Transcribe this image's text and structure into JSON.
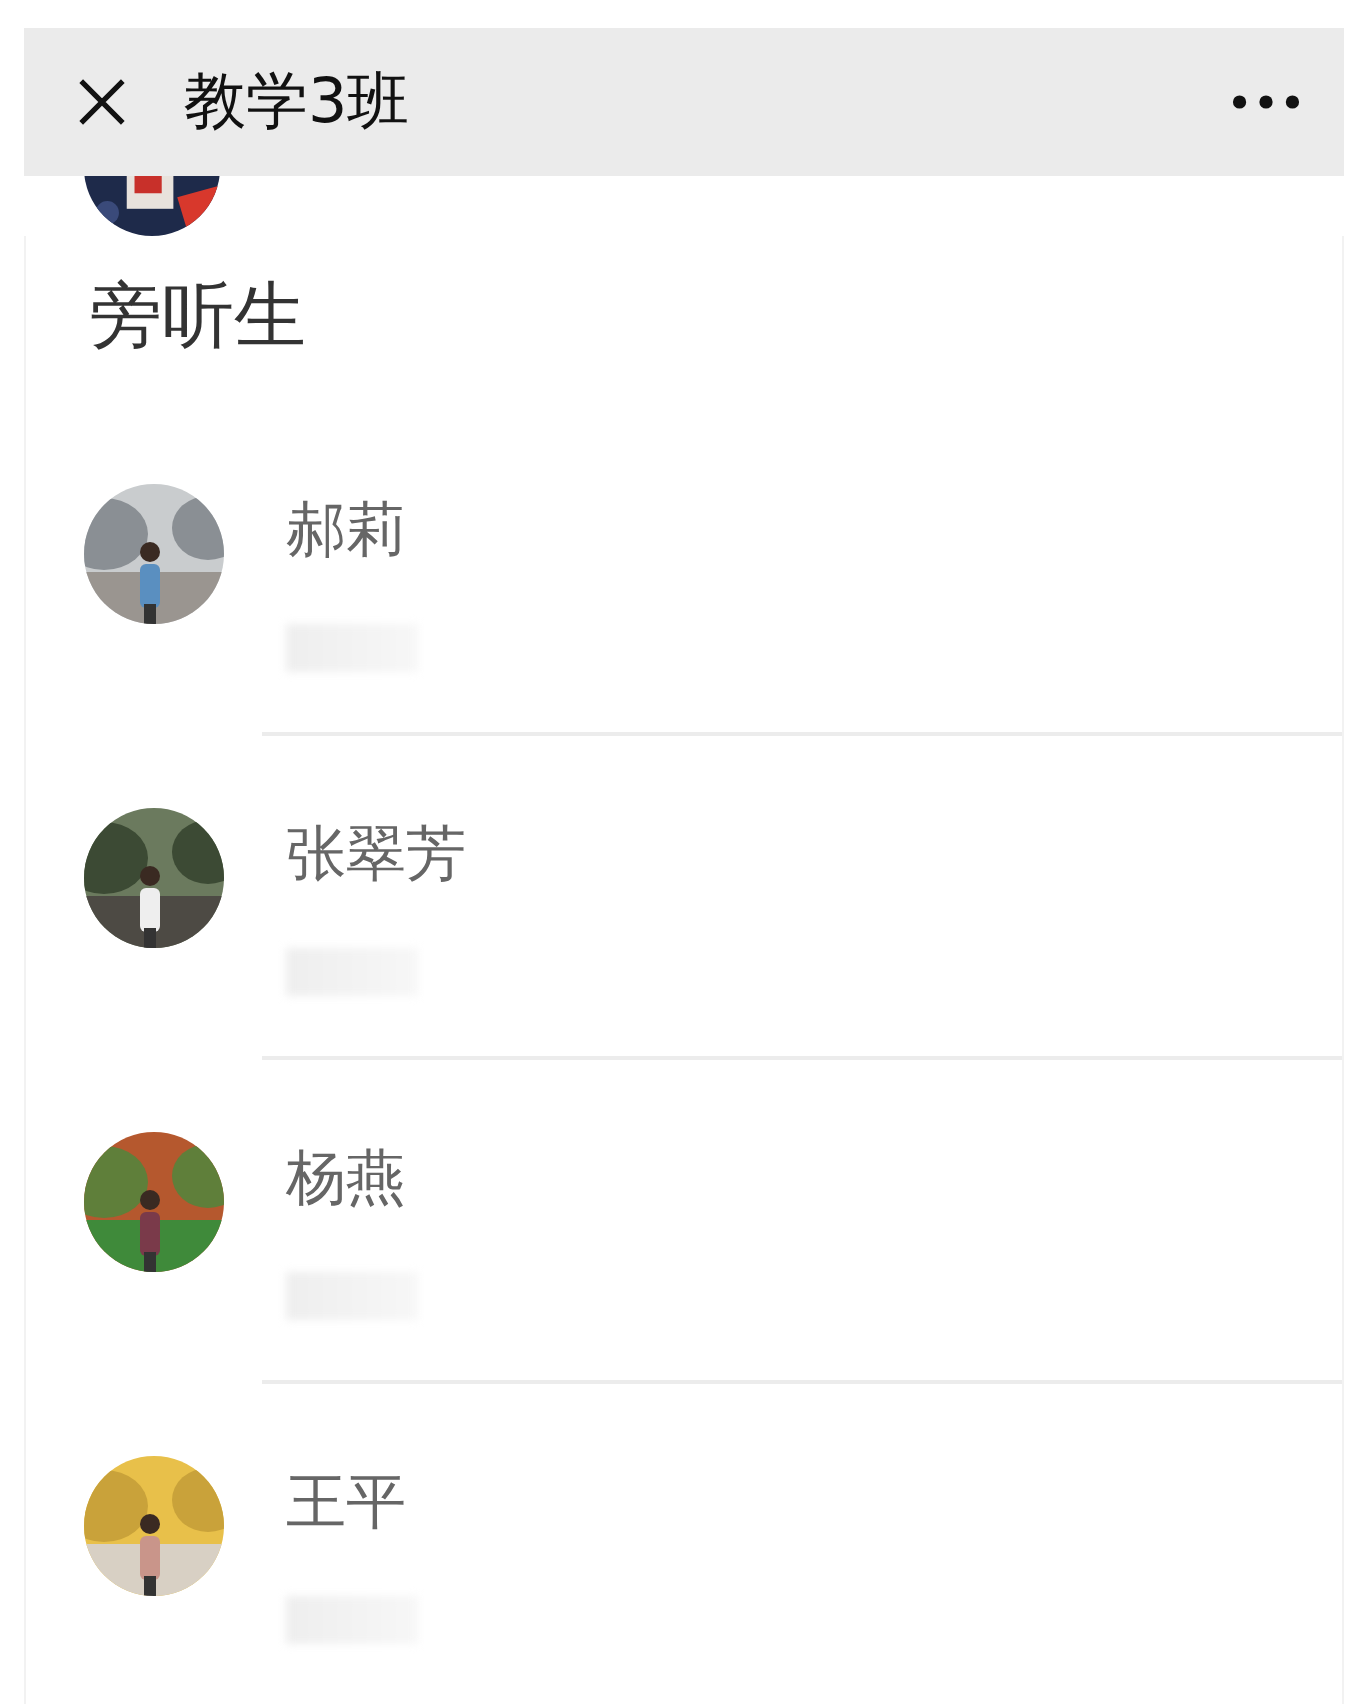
{
  "header": {
    "title": "教学3班"
  },
  "section_title": "旁听生",
  "members": [
    {
      "name": "郝莉"
    },
    {
      "name": "张翠芳"
    },
    {
      "name": "杨燕"
    },
    {
      "name": "王平"
    }
  ]
}
